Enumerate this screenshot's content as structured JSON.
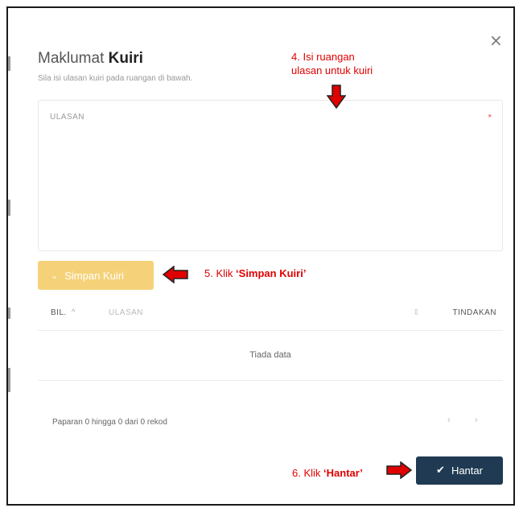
{
  "modal": {
    "title_prefix": "Maklumat",
    "title_bold": "Kuiri",
    "subtitle": "Sila isi ulasan kuiri pada ruangan di bawah.",
    "close_glyph": "×"
  },
  "form": {
    "field_label": "ULASAN",
    "required_mark": "*",
    "save_label": "Simpan Kuiri",
    "save_icon": "chevron-down-icon"
  },
  "table": {
    "columns": [
      "BIL.",
      "ULASAN",
      "TINDAKAN"
    ],
    "sort_glyph": "^",
    "sort_glyph2": "⇕",
    "empty_text": "Tiada data"
  },
  "pagination": {
    "summary": "Paparan 0 hingga 0 dari 0 rekod",
    "prev": "‹",
    "next": "›"
  },
  "footer": {
    "submit_label": "Hantar",
    "submit_icon": "check-icon"
  },
  "annotations": {
    "step4_line1": "4. Isi ruangan",
    "step4_line2": "ulasan untuk kuiri",
    "step5_prefix": "5. Klik",
    "step5_bold": "‘Simpan Kuiri’",
    "step6_prefix": "6. Klik",
    "step6_bold": "‘Hantar’"
  },
  "colors": {
    "annotation": "#e00000",
    "save_button": "#f5d27a",
    "submit_button": "#1f3a52"
  }
}
